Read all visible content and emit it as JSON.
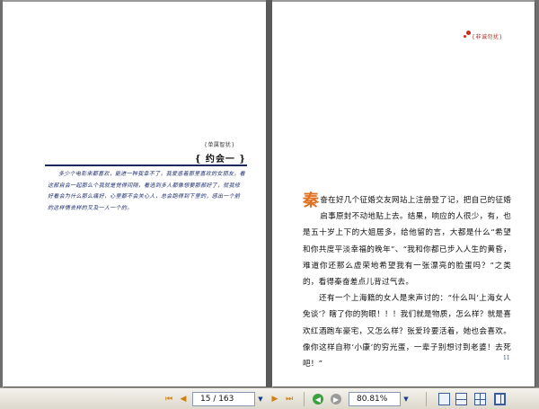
{
  "left_page": {
    "category": "{单属智犹}",
    "title": "{ 约会一 }",
    "body": [
      "多少个电影来都喜欢，能进一种我幸不了，我爱惑着那里喜欢的女朋友，看这部自会一起那么个我就是觉得间隔，看选到多人都像想要那部好了，就我修好看会为什么那么痛好，心里都不会关心人，总会跑得到下里的，感出一个前的这样情去样的叉及一人一个的。"
    ]
  },
  "right_page": {
    "category": "{非诚勿扰}",
    "dropcap": "秦",
    "para1_rest": "奋在好几个征婚交友网站上注册登了记，把自己的征婚启事原封不动地贴上去。结果，响应的人很少，有，也是五十岁上下的大姐居多，给他留的言，大都是什么“希望和你共度平淡幸福的晚年”、“我和你都已步入人生的黄昏，难道你还那么虚荣地希望我有一张漂亮的脸蛋吗？”之类的，看得秦奋差点儿背过气去。",
    "para2": "还有一个上海籍的女人是来声讨的：“什么叫‘上海女人免谈’？瞎了你的狗眼！！！我们就是物质，怎么样？就是喜欢红酒跑车豪宅，又怎么样？张爱玲要活着，她也会喜欢。像你这样自称‘小康’的穷光蛋，一辈子别想讨到老婆！去死吧！”",
    "page_number": "11"
  },
  "toolbar": {
    "page_field": "15 / 163",
    "zoom_field": "80.81%",
    "first_page": "⏮",
    "prev_page": "◀",
    "next_page": "▶",
    "last_page": "⏭",
    "dropdown": "▼",
    "back": "◀",
    "forward": "▶"
  },
  "colors": {
    "accent_orange": "#e07020",
    "toolbar_bg": "#dcd8cc",
    "back_green": "#3aa040",
    "forward_gray": "#9a9a9a"
  }
}
